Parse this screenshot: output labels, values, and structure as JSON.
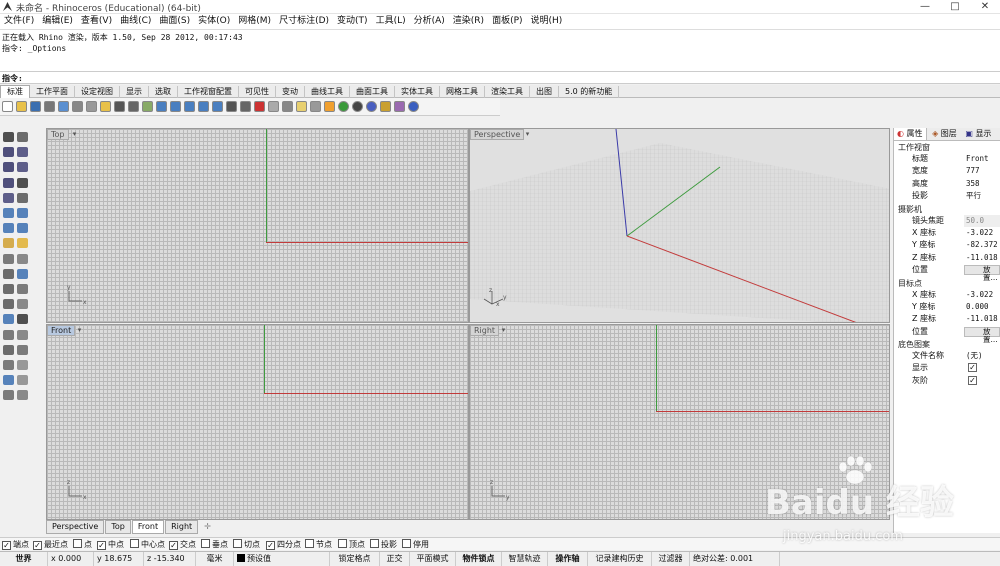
{
  "window": {
    "title": "未命名 - Rhinoceros (Educational) (64-bit)",
    "maximize_glyph": "□"
  },
  "menu": [
    "文件(F)",
    "编辑(E)",
    "查看(V)",
    "曲线(C)",
    "曲面(S)",
    "实体(O)",
    "网格(M)",
    "尺寸标注(D)",
    "变动(T)",
    "工具(L)",
    "分析(A)",
    "渲染(R)",
    "面板(P)",
    "说明(H)"
  ],
  "command_history": [
    "正在载入 Rhino 渲染，版本 1.50, Sep 28 2012, 00:17:43",
    "指令: _Options"
  ],
  "command_prompt": "指令:",
  "toolbar_tabs": [
    "标准",
    "工作平面",
    "设定视图",
    "显示",
    "选取",
    "工作视窗配置",
    "可见性",
    "变动",
    "曲线工具",
    "曲面工具",
    "实体工具",
    "网格工具",
    "渲染工具",
    "出图",
    "5.0 的新功能"
  ],
  "toolbar_icons": [
    "new-file-icon",
    "open-file-icon",
    "save-icon",
    "print-icon",
    "import-icon",
    "cut-icon",
    "copy-icon",
    "paste-icon",
    "undo-icon",
    "pan-icon",
    "rotate-view-icon",
    "zoom-icon",
    "zoom-window-icon",
    "zoom-extents-icon",
    "zoom-selected-icon",
    "zoom-all-icon",
    "viewport-layout-icon",
    "move-icon",
    "select-icon",
    "hide-icon",
    "lock-icon",
    "light-icon",
    "cplane-icon",
    "layer-icon",
    "render-icon",
    "sphere-icon",
    "material-icon",
    "dimension-icon",
    "settings-icon",
    "help-icon"
  ],
  "viewports": {
    "top": {
      "label": "Top",
      "axis_x": "x",
      "axis_y": "y"
    },
    "perspective": {
      "label": "Perspective",
      "axis_x": "x",
      "axis_y": "y",
      "axis_z": "z"
    },
    "front": {
      "label": "Front",
      "axis_x": "x",
      "axis_z": "z"
    },
    "right": {
      "label": "Right",
      "axis_y": "y",
      "axis_z": "z"
    }
  },
  "viewport_tabs": [
    "Perspective",
    "Top",
    "Front",
    "Right"
  ],
  "properties": {
    "tabs": [
      "属性",
      "图层",
      "显示",
      "?"
    ],
    "sections": {
      "viewport": "工作视窗",
      "camera": "摄影机",
      "target": "目标点",
      "background": "底色图案"
    },
    "viewport_rows": [
      {
        "key": "标题",
        "value": "Front"
      },
      {
        "key": "宽度",
        "value": "777"
      },
      {
        "key": "高度",
        "value": "358"
      },
      {
        "key": "投影",
        "value": "平行"
      }
    ],
    "camera_rows": [
      {
        "key": "镜头焦距",
        "value": "50.0"
      },
      {
        "key": "X 座标",
        "value": "-3.022"
      },
      {
        "key": "Y 座标",
        "value": "-82.372"
      },
      {
        "key": "Z 座标",
        "value": "-11.018"
      },
      {
        "key": "位置",
        "value": "放置..."
      }
    ],
    "target_rows": [
      {
        "key": "X 座标",
        "value": "-3.022"
      },
      {
        "key": "Y 座标",
        "value": "0.000"
      },
      {
        "key": "Z 座标",
        "value": "-11.018"
      },
      {
        "key": "位置",
        "value": "放置..."
      }
    ],
    "background_rows": [
      {
        "key": "文件名称",
        "value": "(无)"
      },
      {
        "key": "显示",
        "value": "✓"
      },
      {
        "key": "灰阶",
        "value": "✓"
      }
    ]
  },
  "osnaps": [
    {
      "label": "端点",
      "checked": true
    },
    {
      "label": "最近点",
      "checked": true
    },
    {
      "label": "点",
      "checked": false
    },
    {
      "label": "中点",
      "checked": true
    },
    {
      "label": "中心点",
      "checked": false
    },
    {
      "label": "交点",
      "checked": true
    },
    {
      "label": "垂点",
      "checked": false
    },
    {
      "label": "切点",
      "checked": false
    },
    {
      "label": "四分点",
      "checked": true
    },
    {
      "label": "节点",
      "checked": false
    },
    {
      "label": "顶点",
      "checked": false
    },
    {
      "label": "投影",
      "checked": false
    },
    {
      "label": "停用",
      "checked": false
    }
  ],
  "status": {
    "cplane": "世界",
    "x": "x 0.000",
    "y": "y 18.675",
    "z": "z -15.340",
    "units": "毫米",
    "layer": "预设值",
    "grid_snap": "锁定格点",
    "ortho": "正交",
    "planar": "平面模式",
    "osnap": "物件锁点",
    "smart_track": "智慧轨迹",
    "gumball": "操作轴",
    "history": "记录建构历史",
    "filter": "过滤器",
    "tolerance": "绝对公差: 0.001"
  },
  "watermark": {
    "brand": "Baidu 经验",
    "url": "jingyan.baidu.com"
  },
  "colors": {
    "x_axis": "#c23a3a",
    "y_axis": "#3e9b3e",
    "z_axis": "#3a3aa8",
    "active_label": "#b8c9e0"
  }
}
